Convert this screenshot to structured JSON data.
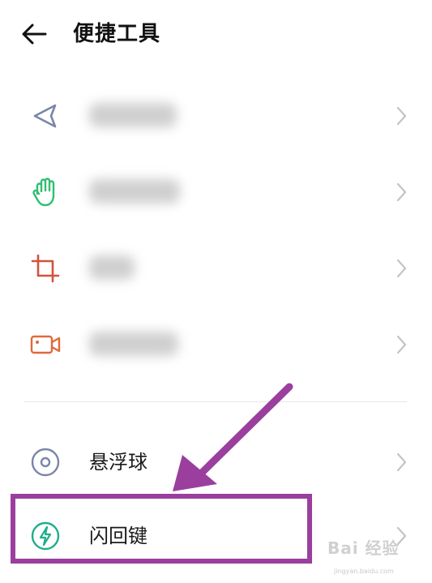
{
  "header": {
    "title": "便捷工具"
  },
  "items": [
    {
      "icon": "navigation-arrow-icon",
      "blurred": true
    },
    {
      "icon": "hand-gesture-icon",
      "blurred": true
    },
    {
      "icon": "crop-icon",
      "blurred": true
    },
    {
      "icon": "video-record-icon",
      "blurred": true
    },
    {
      "icon": "floating-ball-icon",
      "label": "悬浮球"
    },
    {
      "icon": "lightning-icon",
      "label": "闪回键"
    }
  ],
  "colors": {
    "highlight": "#9a3f9e",
    "icon_navigation": "#7a86a8",
    "icon_gesture": "#2fbf71",
    "icon_crop": "#d2533d",
    "icon_video": "#e0693b",
    "icon_float": "#7a86a8",
    "icon_lightning": "#1fae8c"
  },
  "watermark": {
    "text": "Bai 经验",
    "sub": "jingyan.baidu.com"
  }
}
